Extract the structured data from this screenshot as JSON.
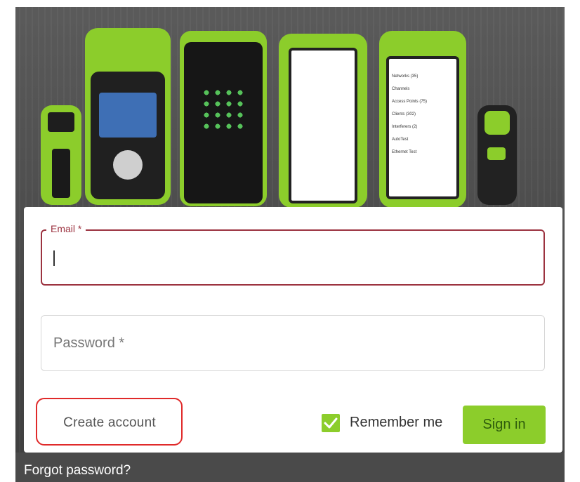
{
  "email": {
    "label": "Email *"
  },
  "password": {
    "placeholder": "Password *"
  },
  "actions": {
    "create_account": "Create account",
    "remember_me": "Remember me",
    "sign_in": "Sign in",
    "forgot_password": "Forgot password?"
  },
  "device_screen": {
    "items": [
      "Networks (35)",
      "Channels",
      "Access Points (75)",
      "Clients (302)",
      "Interferers (2)",
      "AutoTest",
      "Ethernet Test"
    ]
  },
  "icons": {
    "checkbox": "checkmark-icon"
  },
  "colors": {
    "brand_green": "#8ccd2b",
    "error_red": "#9c3340",
    "highlight_red": "#e02a2a"
  },
  "state": {
    "remember_me_checked": true
  }
}
